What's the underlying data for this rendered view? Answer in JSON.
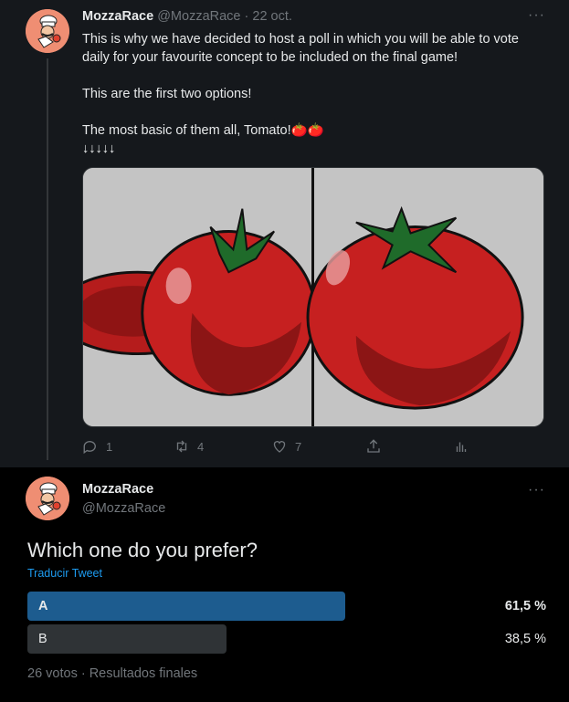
{
  "tweet1": {
    "name": "MozzaRace",
    "handle": "@MozzaRace",
    "sep": " · ",
    "date": "22 oct.",
    "more": "···",
    "lines": [
      "This is why we have decided to host a poll in which you will be able to vote daily for your favourite concept to be included on the final game!",
      "This are the first two options!",
      "The most basic of them all, Tomato!🍅🍅",
      "↓↓↓↓↓"
    ],
    "media_icon": "tomato-concept-art",
    "actions": {
      "reply": "1",
      "retweet": "4",
      "like": "7"
    }
  },
  "tweet2": {
    "name": "MozzaRace",
    "handle": "@MozzaRace",
    "more": "···",
    "text": "Which one do you prefer?",
    "translate": "Traducir Tweet",
    "poll": [
      {
        "label": "A",
        "pct": "61,5 %",
        "fraction": 0.615,
        "color": "#1d5c8f",
        "winner": true
      },
      {
        "label": "B",
        "pct": "38,5 %",
        "fraction": 0.385,
        "color": "#2f3336",
        "winner": false
      }
    ],
    "meta": "26 votos · Resultados finales"
  },
  "colors": {
    "top_bg": "#15181c",
    "accent": "#1d9bf0",
    "avatar_bg": "#ef8e73"
  }
}
